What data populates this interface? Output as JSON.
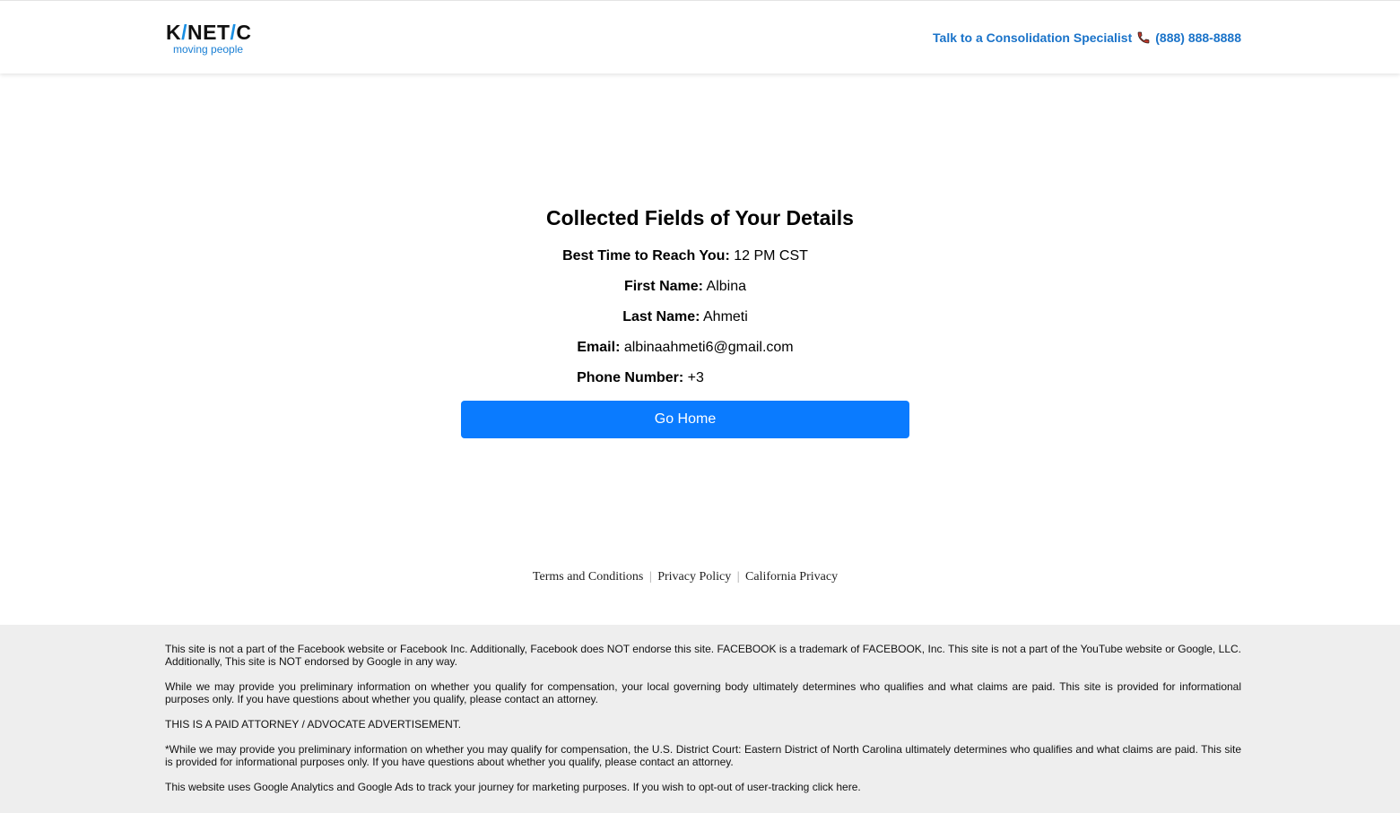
{
  "header": {
    "logo": {
      "part1": "K",
      "slash1": "/",
      "part2": "NET",
      "slash2": "/",
      "part3": "C",
      "tagline": "moving people"
    },
    "contact_label": "Talk to a Consolidation Specialist",
    "phone": "(888) 888-8888",
    "phone_icon": "phone-icon",
    "accent_color": "#1a73c9"
  },
  "main": {
    "title": "Collected Fields of Your Details",
    "fields": [
      {
        "label": "Best Time to Reach You:",
        "value": "12 PM CST"
      },
      {
        "label": "First Name:",
        "value": "Albina"
      },
      {
        "label": "Last Name:",
        "value": "Ahmeti"
      },
      {
        "label": "Email:",
        "value": "albinaahmeti6@gmail.com"
      },
      {
        "label": "Phone Number:",
        "value": "+3"
      }
    ],
    "go_home_label": "Go Home",
    "button_color": "#0a7bff"
  },
  "legal_links": {
    "terms": "Terms and Conditions",
    "privacy": "Privacy Policy",
    "california": "California Privacy",
    "separator": "|"
  },
  "footer": {
    "paragraphs": [
      "This site is not a part of the Facebook website or Facebook Inc. Additionally, Facebook does NOT endorse this site. FACEBOOK is a trademark of FACEBOOK, Inc. This site is not a part of the YouTube website or Google, LLC. Additionally, This site is NOT endorsed by Google in any way.",
      "While we may provide you preliminary information on whether you qualify for compensation, your local governing body ultimately determines who qualifies and what claims are paid. This site is provided for informational purposes only. If you have questions about whether you qualify, please contact an attorney.",
      "THIS IS A PAID ATTORNEY / ADVOCATE ADVERTISEMENT.",
      "*While we may provide you preliminary information on whether you may qualify for compensation, the U.S. District Court: Eastern District of North Carolina ultimately determines who qualifies and what claims are paid. This site is provided for informational purposes only. If you have questions about whether you qualify, please contact an attorney.",
      "This website uses Google Analytics and Google Ads to track your journey for marketing purposes. If you wish to opt-out of user-tracking click here."
    ],
    "background_color": "#eeeeee"
  }
}
